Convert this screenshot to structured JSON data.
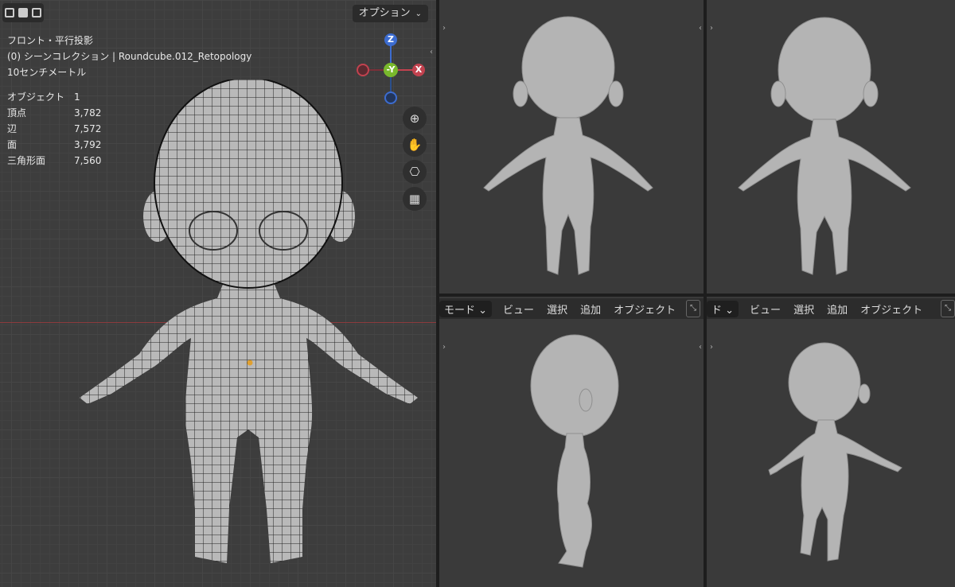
{
  "main_viewport": {
    "view_name": "フロント・平行投影",
    "collection": "(0) シーンコレクション | Roundcube.012_Retopology",
    "scale": "10センチメートル",
    "options_label": "オプション",
    "stats": [
      {
        "label": "オブジェクト",
        "value": "1"
      },
      {
        "label": "頂点",
        "value": "3,782"
      },
      {
        "label": "辺",
        "value": "7,572"
      },
      {
        "label": "面",
        "value": "3,792"
      },
      {
        "label": "三角形面",
        "value": "7,560"
      }
    ],
    "gizmo": {
      "z": "Z",
      "y": "-Y",
      "x": "X"
    },
    "colors": {
      "x_axis": "#c2424f",
      "y_axis": "#79b82c",
      "z_axis": "#3c6cd0",
      "grid": "#3d3d3d"
    }
  },
  "viewport_header": {
    "mode_partial_left": "モード",
    "mode_partial_right": "ド",
    "menu": [
      "ビュー",
      "選択",
      "追加",
      "オブジェクト"
    ]
  }
}
